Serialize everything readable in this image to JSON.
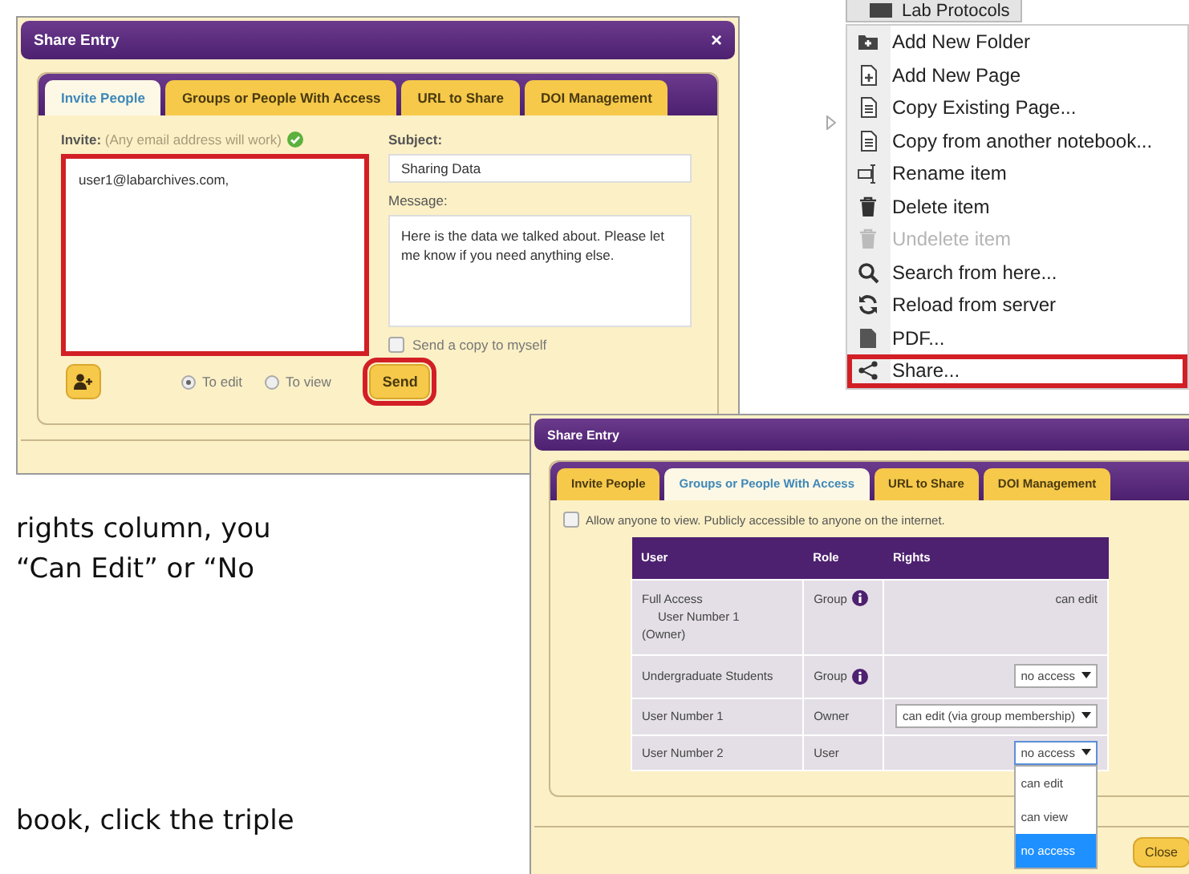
{
  "invite_dialog": {
    "title": "Share Entry",
    "close": "×",
    "tabs": [
      {
        "label": "Invite People",
        "selected": true
      },
      {
        "label": "Groups or People With Access",
        "selected": false
      },
      {
        "label": "URL to Share",
        "selected": false
      },
      {
        "label": "DOI Management",
        "selected": false
      }
    ],
    "invite_label": "Invite:",
    "invite_hint": "(Any email address will work)",
    "invite_valid": true,
    "invite_value": "user1@labarchives.com,",
    "invite_highlighted": true,
    "subject_label": "Subject:",
    "subject_value": "Sharing Data",
    "message_label": "Message:",
    "message_value": "Here is the data we talked about. Please let me know if you need anything else.",
    "copy_checkbox": {
      "label": "Send a copy to myself",
      "checked": false
    },
    "permissions": [
      {
        "label": "To edit",
        "selected": true
      },
      {
        "label": "To view",
        "selected": false
      }
    ],
    "send_button": {
      "label": "Send",
      "highlighted": true
    }
  },
  "context_menu": {
    "header": "Lab Protocols",
    "items": [
      {
        "label": "Add New Folder",
        "disabled": false,
        "highlighted": false
      },
      {
        "label": "Add New Page",
        "disabled": false,
        "highlighted": false
      },
      {
        "label": "Copy Existing Page...",
        "disabled": false,
        "highlighted": false
      },
      {
        "label": "Copy from another notebook...",
        "disabled": false,
        "highlighted": false
      },
      {
        "label": "Rename item",
        "disabled": false,
        "highlighted": false
      },
      {
        "label": "Delete item",
        "disabled": false,
        "highlighted": false
      },
      {
        "label": "Undelete item",
        "disabled": true,
        "highlighted": false
      },
      {
        "label": "Search from here...",
        "disabled": false,
        "highlighted": false
      },
      {
        "label": "Reload from server",
        "disabled": false,
        "highlighted": false
      },
      {
        "label": "PDF...",
        "disabled": false,
        "highlighted": false
      },
      {
        "label": "Share...",
        "disabled": false,
        "highlighted": true
      }
    ]
  },
  "access_dialog": {
    "title": "Share Entry",
    "tabs": [
      {
        "label": "Invite People",
        "selected": false
      },
      {
        "label": "Groups or People With Access",
        "selected": true
      },
      {
        "label": "URL to Share",
        "selected": false
      },
      {
        "label": "DOI Management",
        "selected": false
      }
    ],
    "public_checkbox": {
      "label": "Allow anyone to view. Publicly accessible to anyone on the internet.",
      "checked": false
    },
    "table": {
      "columns": [
        "User",
        "Role",
        "Rights"
      ],
      "rows": [
        {
          "user": [
            "Full Access",
            "User Number 1",
            "(Owner)"
          ],
          "role": "Group",
          "role_info": true,
          "rights": {
            "kind": "text",
            "value": "can edit"
          }
        },
        {
          "user": [
            "Undergraduate Students"
          ],
          "role": "Group",
          "role_info": true,
          "rights": {
            "kind": "select",
            "value": "no access"
          }
        },
        {
          "user": [
            "User Number 1"
          ],
          "role": "Owner",
          "role_info": false,
          "rights": {
            "kind": "select",
            "value": "can edit (via group membership)"
          }
        },
        {
          "user": [
            "User Number 2"
          ],
          "role": "User",
          "role_info": false,
          "rights": {
            "kind": "select",
            "value": "no access",
            "expanded": true,
            "options": [
              {
                "label": "can edit",
                "selected": false
              },
              {
                "label": "can view",
                "selected": false
              },
              {
                "label": "no access",
                "selected": true
              }
            ]
          }
        }
      ]
    },
    "close_button": "Close"
  },
  "document_text": [
    "rights column, you",
    "“Can Edit” or “No",
    "book, click the triple"
  ]
}
